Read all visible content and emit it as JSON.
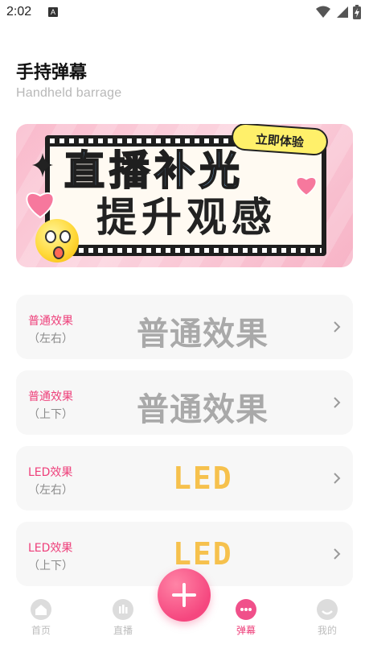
{
  "status_bar": {
    "time": "2:02",
    "indicator": "A"
  },
  "header": {
    "title": "手持弹幕",
    "subtitle": "Handheld barrage"
  },
  "banner": {
    "headline_1": "直播补光",
    "headline_2": "提升观感",
    "cta_label": "立即体验"
  },
  "effects": [
    {
      "label": "普通效果",
      "sub": "（左右）",
      "preview": "普通效果"
    },
    {
      "label": "普通效果",
      "sub": "（上下）",
      "preview": "普通效果"
    },
    {
      "label": "LED效果",
      "sub": "（左右）",
      "preview": "LED"
    },
    {
      "label": "LED效果",
      "sub": "（上下）",
      "preview": "LED"
    }
  ],
  "tabbar": {
    "items": [
      {
        "label": "首页",
        "icon": "home-icon"
      },
      {
        "label": "直播",
        "icon": "live-icon"
      },
      {
        "label": "弹幕",
        "icon": "barrage-icon",
        "active": true
      },
      {
        "label": "我的",
        "icon": "profile-icon"
      }
    ],
    "fab_icon": "plus-icon"
  },
  "colors": {
    "accent": "#ee3f7a",
    "led": "#f6c14d",
    "card_bg": "#f7f7f7",
    "inactive": "#bdbdbd"
  }
}
